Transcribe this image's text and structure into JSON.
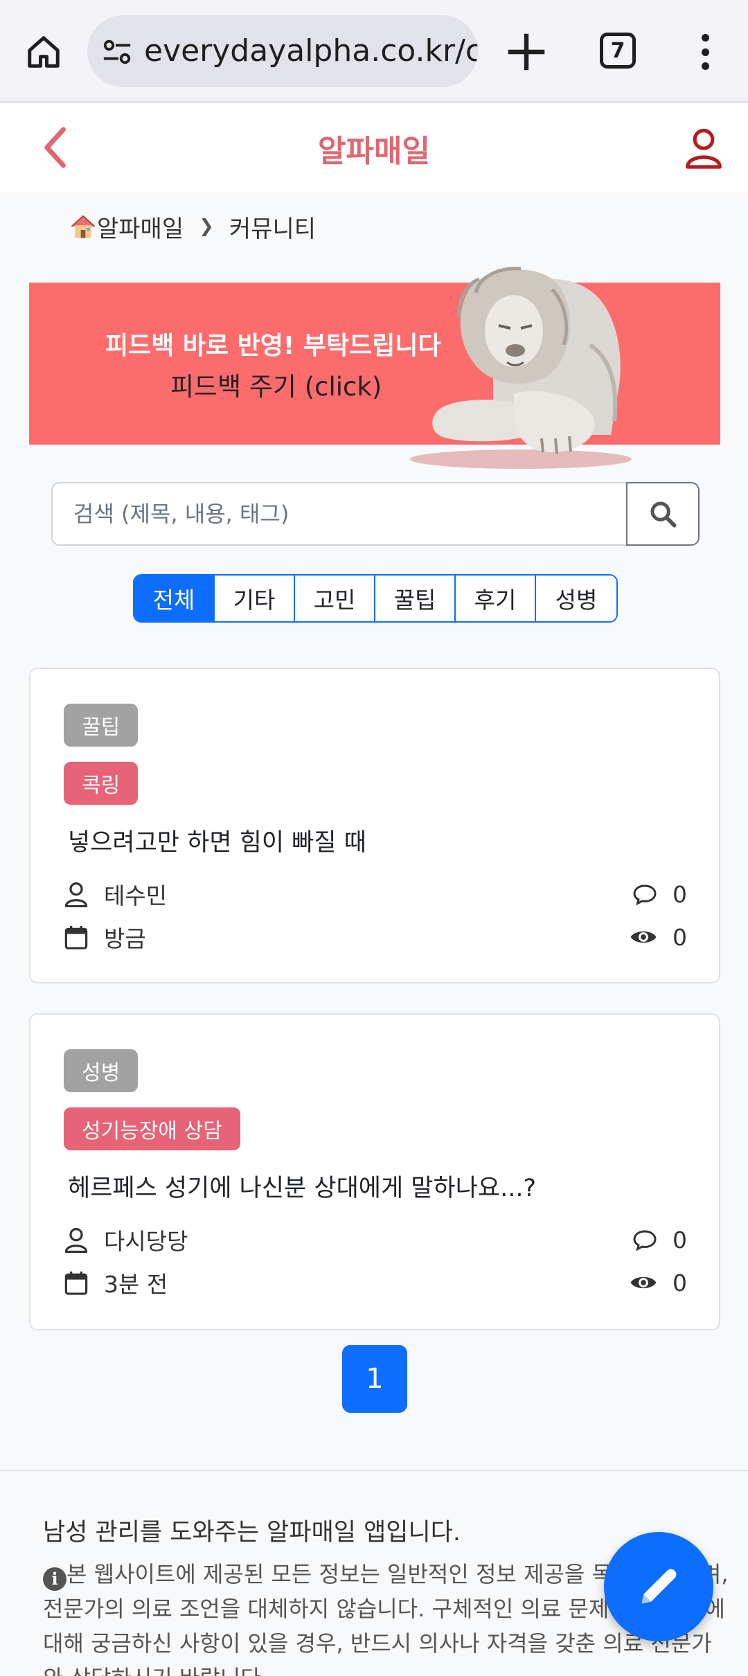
{
  "browser": {
    "url": "everydayalpha.co.kr/c",
    "tab_count": "7"
  },
  "header": {
    "title": "알파매일"
  },
  "breadcrumb": {
    "home": "알파매일",
    "current": "커뮤니티"
  },
  "banner": {
    "line1": "피드백 바로 반영! 부탁드립니다",
    "line2": "피드백 주기 (click)"
  },
  "search": {
    "placeholder": "검색 (제목, 내용, 태그)"
  },
  "categories": [
    "전체",
    "기타",
    "고민",
    "꿀팁",
    "후기",
    "성병"
  ],
  "posts": [
    {
      "category": "꿀팁",
      "tag": "콕링",
      "title": "넣으려고만 하면 힘이 빠질 때",
      "author": "테수민",
      "time": "방금",
      "comments": "0",
      "views": "0"
    },
    {
      "category": "성병",
      "tag": "성기능장애 상담",
      "title": "헤르페스 성기에 나신분 상대에게 말하나요...?",
      "author": "다시당당",
      "time": "3분 전",
      "comments": "0",
      "views": "0"
    }
  ],
  "pagination": {
    "current": "1"
  },
  "footer": {
    "description": "남성 관리를 도와주는 알파매일 앱입니다.",
    "notice": "본 웹사이트에 제공된 모든 정보는 일반적인 정보 제공을 목적으로 하며, 전문가의 의료 조언을 대체하지 않습니다. 구체적인 의료 문제나 증상 등에 대해 궁금하신 사항이 있을 경우, 반드시 의사나 자격을 갖춘 의료 전문가와 상담하시기 바랍니다."
  },
  "colors": {
    "brand": "#e0676f",
    "primary": "#0d6efd",
    "banner": "#fd6c6c",
    "badge_gray": "#a2a2a2",
    "badge_pink": "#e76377"
  }
}
